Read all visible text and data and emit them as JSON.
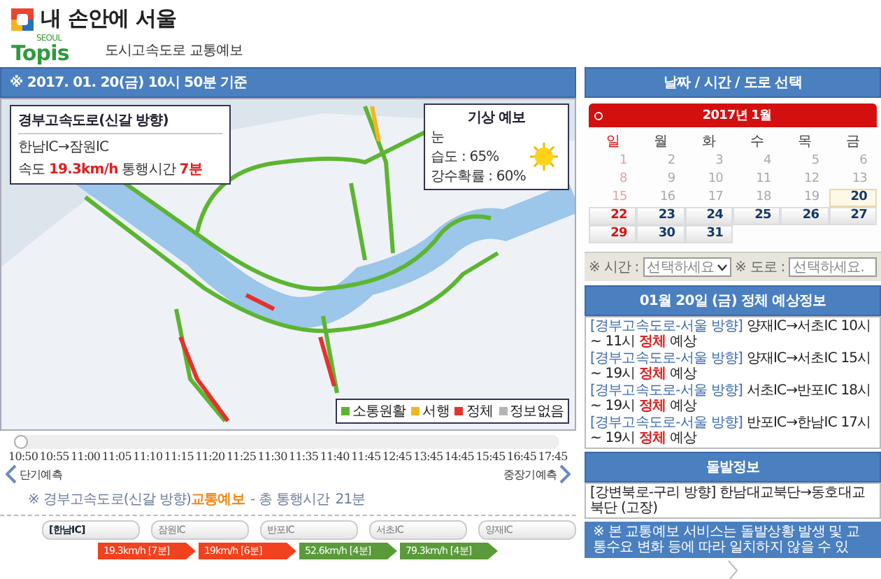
{
  "header": {
    "app_title": "내 손안에 서울",
    "logo_small": "SEOUL",
    "logo": "Topis",
    "subtitle": "도시고속도로 교통예보"
  },
  "timestamp_bar": "※ 2017. 01. 20(금) 10시 50분 기준",
  "map": {
    "route_box": {
      "title": "경부고속도로(신갈 방향)",
      "segment": "한남IC→잠원IC",
      "speed_label": "속도",
      "speed": "19.3km/h",
      "time_label": "통행시간",
      "time": "7분"
    },
    "weather": {
      "title": "기상 예보",
      "condition": "눈",
      "humidity": "습도 : 65%",
      "precipitation": "강수확률 : 60%"
    },
    "legend": [
      {
        "label": "소통원활",
        "color": "#5cb531"
      },
      {
        "label": "서행",
        "color": "#f2b622"
      },
      {
        "label": "정체",
        "color": "#e5322d"
      },
      {
        "label": "정보없음",
        "color": "#b5b5b5"
      }
    ]
  },
  "timeline": {
    "level": 0,
    "times": [
      "10:50",
      "10:55",
      "11:00",
      "11:05",
      "11:10",
      "11:15",
      "11:20",
      "11:25",
      "11:30",
      "11:35",
      "11:40",
      "11:45",
      "12:45",
      "13:45",
      "14:45",
      "15:45",
      "16:45",
      "17:45"
    ],
    "left_label": "단기예측",
    "right_label": "중장기예측"
  },
  "route_summary": {
    "prefix": "※ 경부고속도로(신갈 방향)",
    "highlight": "교통예보",
    "suffix": "- 총 통행시간",
    "total": "21분"
  },
  "route": {
    "nodes": [
      {
        "label": "[한남IC]",
        "selected": true
      },
      {
        "label": "잠원IC",
        "selected": false
      },
      {
        "label": "반포IC",
        "selected": false
      },
      {
        "label": "서초IC",
        "selected": false
      },
      {
        "label": "양재IC",
        "selected": false
      }
    ],
    "segments": [
      {
        "label": "19.3km/h [7분]",
        "color": "#f0421e"
      },
      {
        "label": "19km/h [6분]",
        "color": "#f0421e"
      },
      {
        "label": "52.6km/h [4분]",
        "color": "#5a9a3a"
      },
      {
        "label": "79.3km/h [4분]",
        "color": "#5a9a3a"
      }
    ]
  },
  "selector": {
    "title": "날짜 / 시간 / 도로 선택",
    "month": "2017년 1월",
    "weekdays": [
      "일",
      "월",
      "화",
      "수",
      "목",
      "금"
    ],
    "weeks": [
      [
        {
          "day": "1",
          "disabled": true,
          "selected": false
        },
        {
          "day": "2",
          "disabled": true,
          "selected": false
        },
        {
          "day": "3",
          "disabled": true,
          "selected": false
        },
        {
          "day": "4",
          "disabled": true,
          "selected": false
        },
        {
          "day": "5",
          "disabled": true,
          "selected": false
        },
        {
          "day": "6",
          "disabled": true,
          "selected": false
        }
      ],
      [
        {
          "day": "8",
          "disabled": true,
          "selected": false
        },
        {
          "day": "9",
          "disabled": true,
          "selected": false
        },
        {
          "day": "10",
          "disabled": true,
          "selected": false
        },
        {
          "day": "11",
          "disabled": true,
          "selected": false
        },
        {
          "day": "12",
          "disabled": true,
          "selected": false
        },
        {
          "day": "13",
          "disabled": true,
          "selected": false
        }
      ],
      [
        {
          "day": "15",
          "disabled": true,
          "selected": false
        },
        {
          "day": "16",
          "disabled": true,
          "selected": false
        },
        {
          "day": "17",
          "disabled": true,
          "selected": false
        },
        {
          "day": "18",
          "disabled": true,
          "selected": false
        },
        {
          "day": "19",
          "disabled": true,
          "selected": false
        },
        {
          "day": "20",
          "disabled": false,
          "selected": true
        }
      ],
      [
        {
          "day": "22",
          "disabled": false,
          "selected": false
        },
        {
          "day": "23",
          "disabled": false,
          "selected": false
        },
        {
          "day": "24",
          "disabled": false,
          "selected": false
        },
        {
          "day": "25",
          "disabled": false,
          "selected": false
        },
        {
          "day": "26",
          "disabled": false,
          "selected": false
        },
        {
          "day": "27",
          "disabled": false,
          "selected": false
        }
      ],
      [
        {
          "day": "29",
          "disabled": false,
          "selected": false
        },
        {
          "day": "30",
          "disabled": false,
          "selected": false
        },
        {
          "day": "31",
          "disabled": false,
          "selected": false
        }
      ]
    ],
    "time_label": "※ 시간 :",
    "time_placeholder": "선택하세요",
    "road_label": "※ 도로 :",
    "road_placeholder": "선택하세요."
  },
  "congestion": {
    "title": "01월 20일 (금) 정체 예상정보",
    "items": [
      {
        "road": "[경부고속도로-서울 방향]",
        "route": "양재IC→서초IC 10시 ~ 11시",
        "status": "정체",
        "suffix": "예상"
      },
      {
        "road": "[경부고속도로-서울 방향]",
        "route": "양재IC→서초IC 15시 ~ 19시",
        "status": "정체",
        "suffix": "예상"
      },
      {
        "road": "[경부고속도로-서울 방향]",
        "route": "서초IC→반포IC 18시 ~ 19시",
        "status": "정체",
        "suffix": "예상"
      },
      {
        "road": "[경부고속도로-서울 방향]",
        "route": "반포IC→한남IC 17시 ~ 19시",
        "status": "정체",
        "suffix": "예상"
      }
    ]
  },
  "incidents": {
    "title": "돌발정보",
    "items": [
      "[강변북로-구리 방향] 한남대교북단→동호대교북단 (고장)"
    ]
  },
  "notice": "※ 본 교통예보 서비스는 돌발상황 발생 및 교통수요 변화 등에 따라 일치하지 않을 수 있"
}
